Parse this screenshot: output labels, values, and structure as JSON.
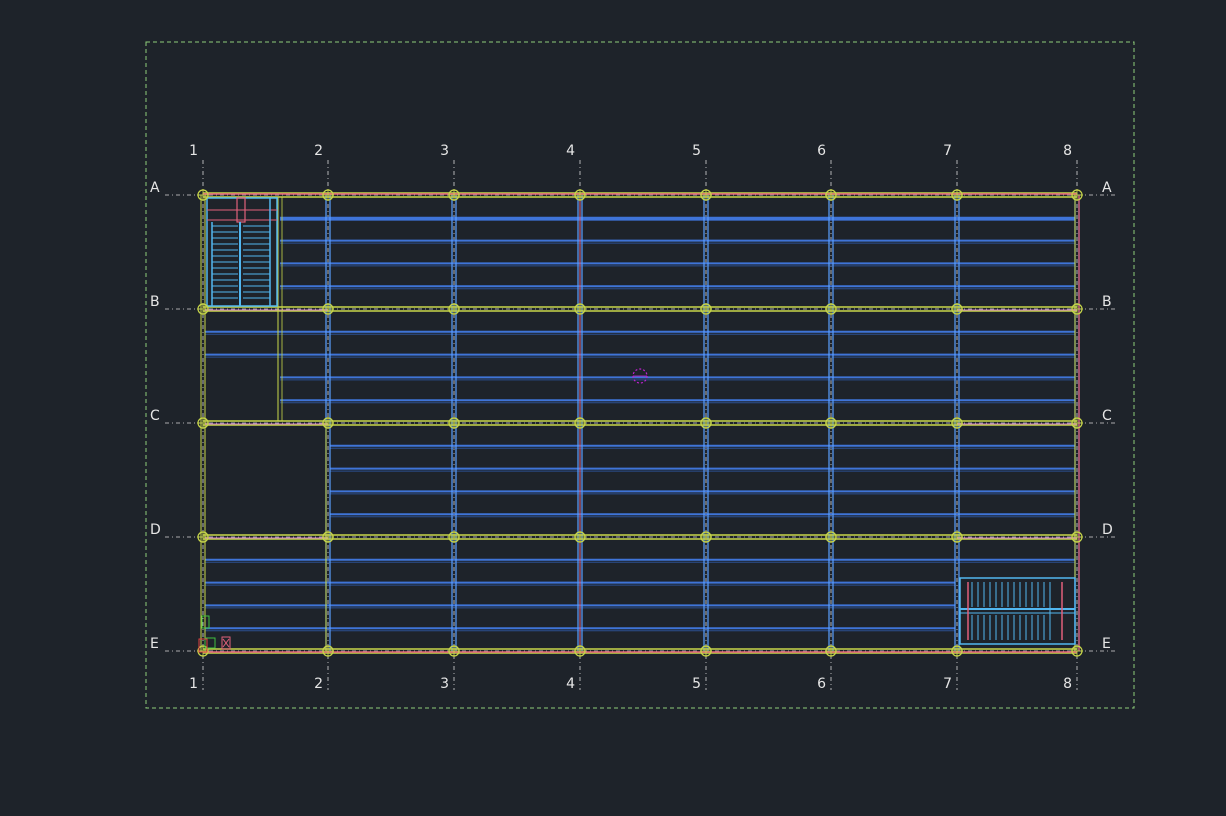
{
  "grid": {
    "columns": [
      "1",
      "2",
      "3",
      "4",
      "5",
      "6",
      "7",
      "8"
    ],
    "rows": [
      "A",
      "B",
      "C",
      "D",
      "E"
    ]
  },
  "colors": {
    "background": "#1e232a",
    "border": "#8fce7b",
    "grid_line": "#d8d8d8",
    "main_beam": "#c9d84a",
    "secondary_beam": "#3f74d8",
    "column_line": "#5aa0ff",
    "wall": "#e0607a",
    "stair": "#52b7f0",
    "marker": "#c020d0"
  },
  "icons": {
    "ucs": "ucs-axis-icon",
    "center": "center-target-icon"
  }
}
